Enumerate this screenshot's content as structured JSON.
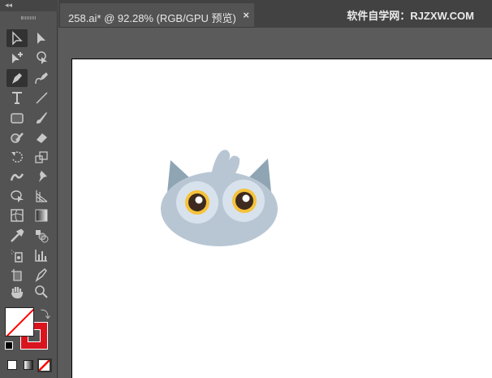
{
  "document_tab": {
    "title": "258.ai* @ 92.28% (RGB/GPU 预览)",
    "close_icon": "×"
  },
  "watermark": "软件自学网：RJZXW.COM",
  "toolbar": {
    "collapse_label": "◂◂"
  },
  "colors": {
    "stroke": "#d9141e",
    "none_slash": "#ff0000",
    "owl_body": "#b8c6d4",
    "owl_ear": "#8fa5b3",
    "eye_white": "#d8e2ed",
    "iris": "#f5c23a",
    "pupil": "#3e2a1e"
  }
}
